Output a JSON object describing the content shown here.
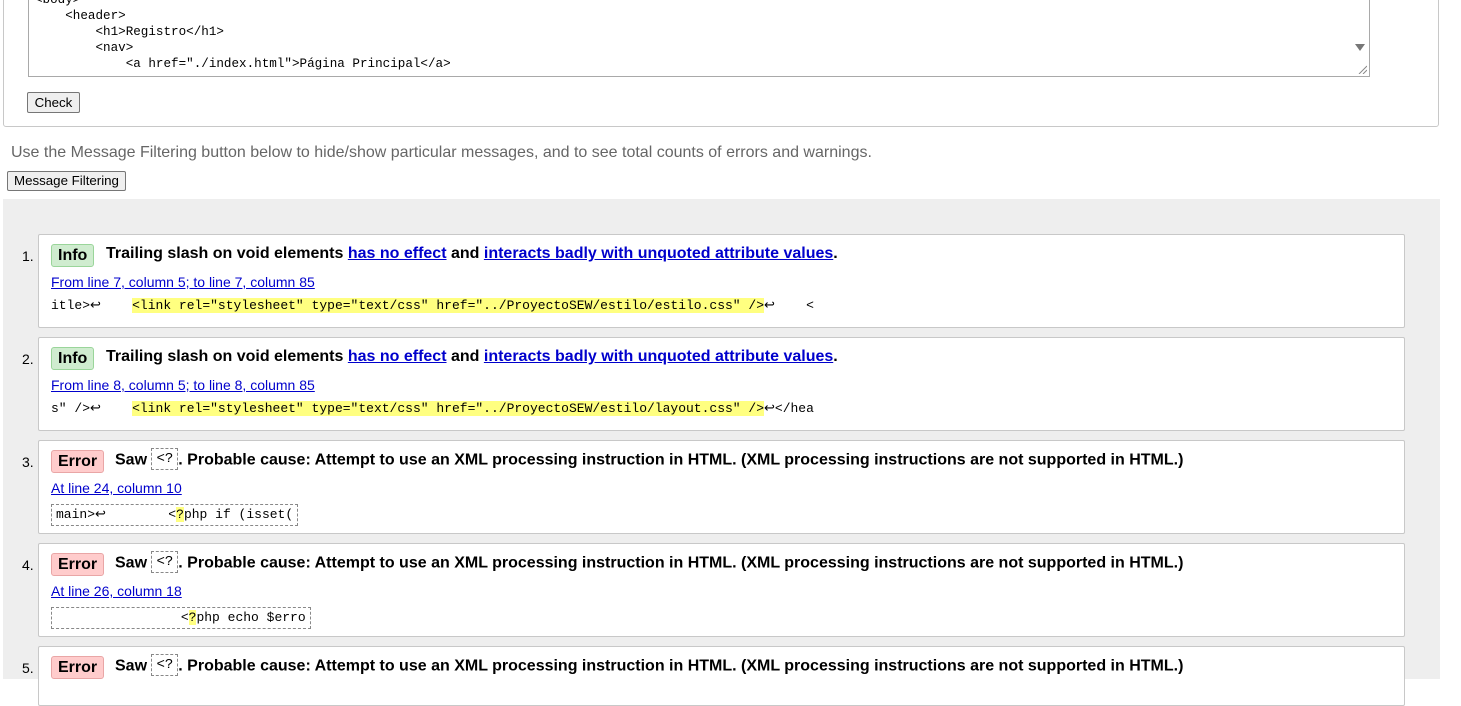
{
  "source_code": {
    "lines": [
      "<body>",
      "    <header>",
      "        <h1>Registro</h1>",
      "        <nav>",
      "            <a href=\"./index.html\">Página Principal</a>"
    ]
  },
  "check_button_label": "Check",
  "filter_note": "Use the Message Filtering button below to hide/show particular messages, and to see total counts of errors and warnings.",
  "filter_button_label": "Message Filtering",
  "messages": [
    {
      "num": "1.",
      "type": "Info",
      "text_a": "Trailing slash on void elements ",
      "link_a": "has no effect",
      "text_b": " and ",
      "link_b": "interacts badly with unquoted attribute values",
      "text_c": ".",
      "location": "From line 7, column 5; to line 7, column 85",
      "extract_pre": "itle>↩    ",
      "extract_hl": "<link rel=\"stylesheet\" type=\"text/css\" href=\"../ProyectoSEW/estilo/estilo.css\" />",
      "extract_post": "↩    <"
    },
    {
      "num": "2.",
      "type": "Info",
      "text_a": "Trailing slash on void elements ",
      "link_a": "has no effect",
      "text_b": " and ",
      "link_b": "interacts badly with unquoted attribute values",
      "text_c": ".",
      "location": "From line 8, column 5; to line 8, column 85",
      "extract_pre": "s\" />↩    ",
      "extract_hl": "<link rel=\"stylesheet\" type=\"text/css\" href=\"../ProyectoSEW/estilo/layout.css\" />",
      "extract_post": "↩</hea"
    },
    {
      "num": "3.",
      "type": "Error",
      "text_a": "Saw ",
      "chip": "<?",
      "text_b": ". Probable cause: Attempt to use an XML processing instruction in HTML. (XML processing instructions are not supported in HTML.)",
      "location": "At line 24, column 10",
      "extract_pre": "main>↩        <",
      "extract_hl": "?",
      "extract_post": "php if (isset("
    },
    {
      "num": "4.",
      "type": "Error",
      "text_a": "Saw ",
      "chip": "<?",
      "text_b": ". Probable cause: Attempt to use an XML processing instruction in HTML. (XML processing instructions are not supported in HTML.)",
      "location": "At line 26, column 18",
      "extract_pre": "                <",
      "extract_hl": "?",
      "extract_post": "php echo $erro"
    },
    {
      "num": "5.",
      "type": "Error",
      "text_a": "Saw ",
      "chip": "<?",
      "text_b": ". Probable cause: Attempt to use an XML processing instruction in HTML. (XML processing instructions are not supported in HTML.)"
    }
  ]
}
